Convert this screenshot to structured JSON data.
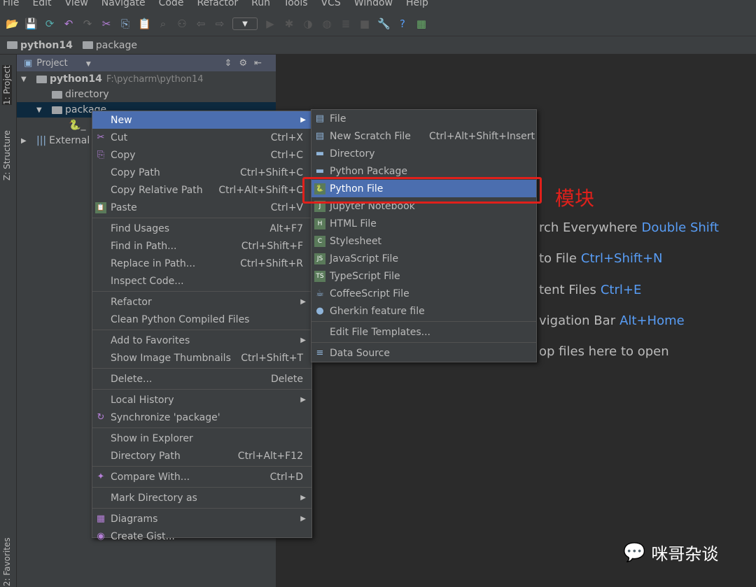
{
  "menubar": [
    "File",
    "Edit",
    "View",
    "Navigate",
    "Code",
    "Refactor",
    "Run",
    "Tools",
    "VCS",
    "Window",
    "Help"
  ],
  "toolbar": [
    "open-icon",
    "save-icon",
    "sync-icon",
    "undo-icon",
    "redo-icon",
    "cut-icon",
    "copy-icon",
    "paste-icon",
    "find-icon",
    "replace-icon",
    "back-icon",
    "forward-icon",
    "run-config-dropdown",
    "run-icon",
    "debug-icon",
    "coverage-icon",
    "profile-icon",
    "concurrency-icon",
    "stop-icon",
    "settings-icon",
    "help-icon",
    "sdk-icon"
  ],
  "breadcrumb": [
    "python14",
    "package"
  ],
  "stripe": {
    "project": "1: Project",
    "structure": "Z: Structure",
    "favorites": "2: Favorites"
  },
  "project": {
    "title": "Project",
    "root": "python14",
    "root_path": "F:\\pycharm\\python14",
    "directory": "directory",
    "package": "package",
    "file": "_",
    "external": "External"
  },
  "context_menu": [
    {
      "label": "New",
      "arrow": true,
      "highlight": true
    },
    {
      "label": "Cut",
      "shortcut": "Ctrl+X",
      "icon": "✂"
    },
    {
      "label": "Copy",
      "shortcut": "Ctrl+C",
      "icon": "⎘"
    },
    {
      "label": "Copy Path",
      "shortcut": "Ctrl+Shift+C"
    },
    {
      "label": "Copy Relative Path",
      "shortcut": "Ctrl+Alt+Shift+C"
    },
    {
      "label": "Paste",
      "shortcut": "Ctrl+V",
      "icon": "📋"
    },
    {
      "sep": true
    },
    {
      "label": "Find Usages",
      "shortcut": "Alt+F7"
    },
    {
      "label": "Find in Path...",
      "shortcut": "Ctrl+Shift+F"
    },
    {
      "label": "Replace in Path...",
      "shortcut": "Ctrl+Shift+R"
    },
    {
      "label": "Inspect Code..."
    },
    {
      "sep": true
    },
    {
      "label": "Refactor",
      "arrow": true
    },
    {
      "label": "Clean Python Compiled Files"
    },
    {
      "sep": true
    },
    {
      "label": "Add to Favorites",
      "arrow": true
    },
    {
      "label": "Show Image Thumbnails",
      "shortcut": "Ctrl+Shift+T"
    },
    {
      "sep": true
    },
    {
      "label": "Delete...",
      "shortcut": "Delete"
    },
    {
      "sep": true
    },
    {
      "label": "Local History",
      "arrow": true
    },
    {
      "label": "Synchronize 'package'",
      "icon": "↻"
    },
    {
      "sep": true
    },
    {
      "label": "Show in Explorer"
    },
    {
      "label": "Directory Path",
      "shortcut": "Ctrl+Alt+F12"
    },
    {
      "sep": true
    },
    {
      "label": "Compare With...",
      "shortcut": "Ctrl+D",
      "icon": "✦"
    },
    {
      "sep": true
    },
    {
      "label": "Mark Directory as",
      "arrow": true
    },
    {
      "sep": true
    },
    {
      "label": "Diagrams",
      "arrow": true,
      "icon": "▦"
    },
    {
      "label": "Create Gist...",
      "icon": "◉"
    }
  ],
  "submenu": [
    {
      "label": "File",
      "icon": "▤"
    },
    {
      "label": "New Scratch File",
      "shortcut": "Ctrl+Alt+Shift+Insert",
      "icon": "▤"
    },
    {
      "label": "Directory",
      "icon": "▬"
    },
    {
      "label": "Python Package",
      "icon": "▬"
    },
    {
      "label": "Python File",
      "icon": "🐍",
      "highlight": true
    },
    {
      "label": "Jupyter Notebook",
      "icon": "J"
    },
    {
      "label": "HTML File",
      "icon": "H"
    },
    {
      "label": "Stylesheet",
      "icon": "C"
    },
    {
      "label": "JavaScript File",
      "icon": "JS"
    },
    {
      "label": "TypeScript File",
      "icon": "TS"
    },
    {
      "label": "CoffeeScript File",
      "icon": "☕"
    },
    {
      "label": "Gherkin feature file",
      "icon": "●"
    },
    {
      "sep": true
    },
    {
      "label": "Edit File Templates..."
    },
    {
      "sep": true
    },
    {
      "label": "Data Source",
      "icon": "≡"
    }
  ],
  "annotation": {
    "label": "模块",
    "color": "#e0201b"
  },
  "editor_hints": [
    {
      "text": "rch Everywhere",
      "key": "Double Shift"
    },
    {
      "text": "to File",
      "key": "Ctrl+Shift+N"
    },
    {
      "text": "tent Files",
      "key": "Ctrl+E"
    },
    {
      "text": "vigation Bar",
      "key": "Alt+Home"
    },
    {
      "text": "op files here to open",
      "key": ""
    }
  ],
  "watermark": "咪哥杂谈",
  "colors": {
    "highlight": "#4b6eaf",
    "shortcut_key": "#589df6",
    "panel": "#3c3f41",
    "editor": "#2b2b2b"
  }
}
